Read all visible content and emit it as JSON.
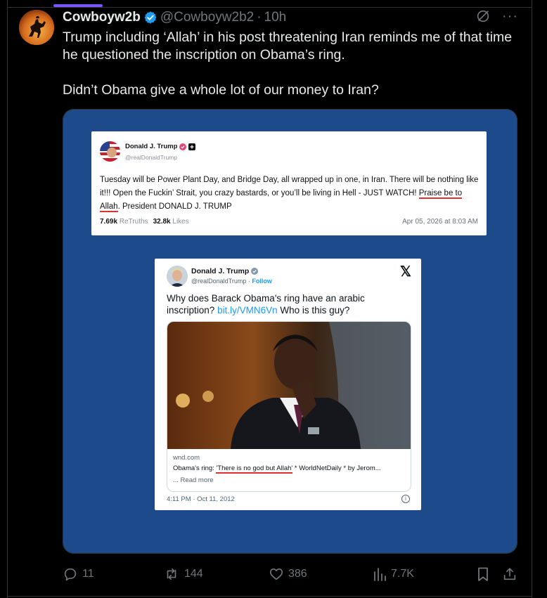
{
  "tweet": {
    "display_name": "Cowboyw2b",
    "handle": "@Cowboyw2b2",
    "separator": "·",
    "time": "10h",
    "text_line1": "Trump including ‘Allah’ in his post threatening Iran reminds me of that time he questioned the inscription on Obama’s ring.",
    "text_line2": "Didn’t Obama give a whole lot of our money to Iran?",
    "more": "···"
  },
  "embedded_post_1": {
    "name": "Donald J. Trump",
    "handle": "@realDonaldTrump",
    "body_before": "Tuesday will be Power Plant Day, and Bridge Day, all wrapped up in one, in Iran. There will be nothing like it!!! Open the Fuckin’ Strait, you crazy bastards, or you’ll be living in Hell - JUST WATCH! ",
    "body_highlight": "Praise be to Allah",
    "body_after": ". President DONALD J. TRUMP",
    "retruths_count": "7.69k",
    "retruths_label": "ReTruths",
    "likes_count": "32.8k",
    "likes_label": "Likes",
    "date": "Apr 05, 2026 at 8:03 AM"
  },
  "embedded_post_2": {
    "name": "Donald J. Trump",
    "handle": "@realDonaldTrump",
    "separator": "·",
    "follow": "Follow",
    "x_logo": "𝕏",
    "body_text": "Why does Barack Obama's ring have an arabic inscription?",
    "link": "bit.ly/VMN6Vn",
    "body_after": " Who is this guy?",
    "card_domain": "wnd.com",
    "card_title_before": "Obama's ring: ",
    "card_title_highlight": "'There is no god but Allah'",
    "card_title_after": " * WorldNetDaily * by Jerom...",
    "card_readmore": "... Read more",
    "timestamp": "4:11 PM · Oct 11, 2012",
    "info": "i"
  },
  "actions": {
    "replies": "11",
    "reposts": "144",
    "likes": "386",
    "views": "7.7K"
  },
  "colors": {
    "background": "#000000",
    "media_blue": "#1c4a8b",
    "accent": "#1d9bf0",
    "highlight_red": "#e03131",
    "muted": "#71767b"
  },
  "icons": [
    "verified-badge-icon",
    "grok-icon",
    "more-icon",
    "reply-icon",
    "repost-icon",
    "like-icon",
    "views-icon",
    "bookmark-icon",
    "share-icon"
  ]
}
